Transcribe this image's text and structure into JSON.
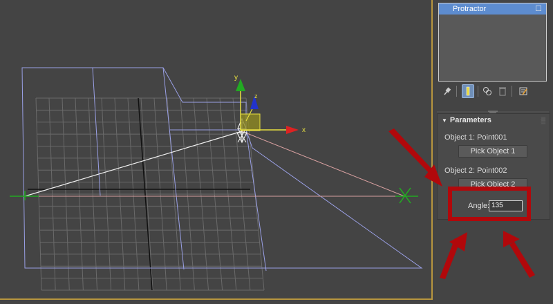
{
  "viewport": {
    "axis_x_label": "x",
    "axis_y_label": "y",
    "axis_z_label": "z",
    "colors": {
      "grid": "#6a6a6a",
      "plane": "#9aa0e6",
      "axis_x": "#dd2222",
      "axis_y": "#22aa22",
      "axis_z": "#2233cc",
      "gizmo": "#c8c02a",
      "frame": "#b8963e"
    }
  },
  "modifier_list": {
    "items": [
      {
        "label": "Protractor",
        "selected": true
      }
    ]
  },
  "toolbar": {
    "icons": [
      "pin-stack-icon",
      "show-end-result-icon",
      "make-unique-icon",
      "remove-modifier-icon",
      "configure-sets-icon"
    ],
    "active": "show-end-result-icon"
  },
  "parameters": {
    "title": "Parameters",
    "object1_label": "Object 1: Point001",
    "object1_button": "Pick Object 1",
    "object2_label": "Object 2: Point002",
    "object2_button": "Pick Object 2",
    "angle_label": "Angle:",
    "angle_value": "135"
  },
  "annotation": {
    "color": "#b1080b"
  }
}
